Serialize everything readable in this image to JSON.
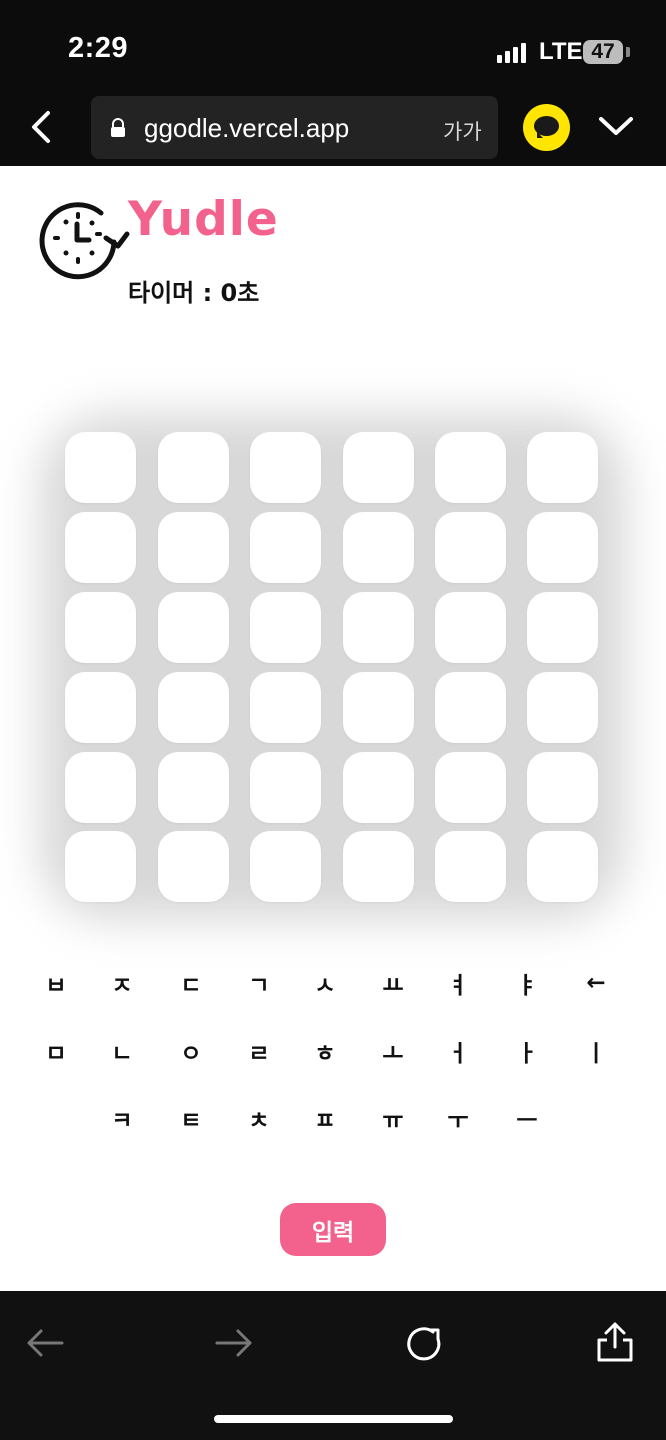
{
  "status_bar": {
    "time": "2:29",
    "network": "LTE",
    "battery": "47"
  },
  "browser": {
    "url": "ggodle.vercel.app",
    "text_size": "가가",
    "icons": {
      "back": "back-icon",
      "lock": "lock-icon",
      "talk": "chat-bubble-icon",
      "menu": "chevron-down-icon"
    }
  },
  "app": {
    "title": "Yudle",
    "timer": "타이머 : 0초",
    "brand_color": "#f2628c"
  },
  "board": {
    "rows": 6,
    "columns": 6,
    "tiles": [
      [
        "",
        "",
        "",
        "",
        "",
        ""
      ],
      [
        "",
        "",
        "",
        "",
        "",
        ""
      ],
      [
        "",
        "",
        "",
        "",
        "",
        ""
      ],
      [
        "",
        "",
        "",
        "",
        "",
        ""
      ],
      [
        "",
        "",
        "",
        "",
        "",
        ""
      ],
      [
        "",
        "",
        "",
        "",
        "",
        ""
      ]
    ]
  },
  "keyboard": {
    "rows": [
      [
        "ㅂ",
        "ㅈ",
        "ㄷ",
        "ㄱ",
        "ㅅ",
        "ㅛ",
        "ㅕ",
        "ㅑ",
        "←"
      ],
      [
        "ㅁ",
        "ㄴ",
        "ㅇ",
        "ㄹ",
        "ㅎ",
        "ㅗ",
        "ㅓ",
        "ㅏ",
        "ㅣ"
      ],
      [
        "ㅋ",
        "ㅌ",
        "ㅊ",
        "ㅍ",
        "ㅠ",
        "ㅜ",
        "ㅡ"
      ]
    ],
    "submit_label": "입력"
  },
  "bottom_bar": {
    "icons": [
      "back-arrow-icon",
      "forward-arrow-icon",
      "reload-icon",
      "share-icon"
    ]
  }
}
